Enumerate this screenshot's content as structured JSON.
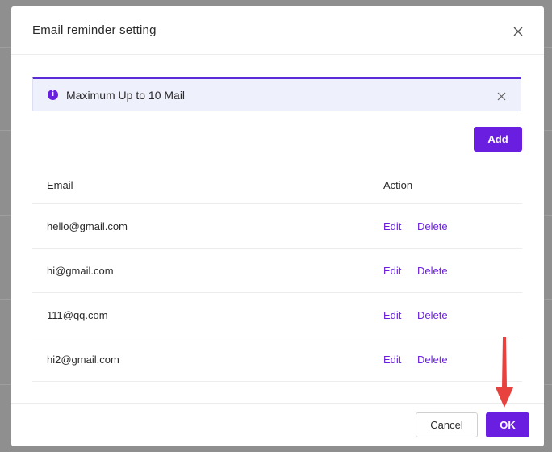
{
  "dialog": {
    "title": "Email reminder setting"
  },
  "alert": {
    "icon": "info-icon",
    "icon_glyph": "i",
    "message": "Maximum Up to 10 Mail"
  },
  "toolbar": {
    "add_label": "Add"
  },
  "table": {
    "columns": [
      "Email",
      "Action"
    ],
    "rows": [
      {
        "email": "hello@gmail.com",
        "edit": "Edit",
        "delete": "Delete"
      },
      {
        "email": "hi@gmail.com",
        "edit": "Edit",
        "delete": "Delete"
      },
      {
        "email": "111@qq.com",
        "edit": "Edit",
        "delete": "Delete"
      },
      {
        "email": "hi2@gmail.com",
        "edit": "Edit",
        "delete": "Delete"
      }
    ]
  },
  "footer": {
    "cancel_label": "Cancel",
    "ok_label": "OK"
  },
  "colors": {
    "accent": "#6a1fe0",
    "alert_border": "#5a2bd6",
    "alert_bg": "#eef0fc",
    "annotation_arrow": "#e8423f"
  }
}
